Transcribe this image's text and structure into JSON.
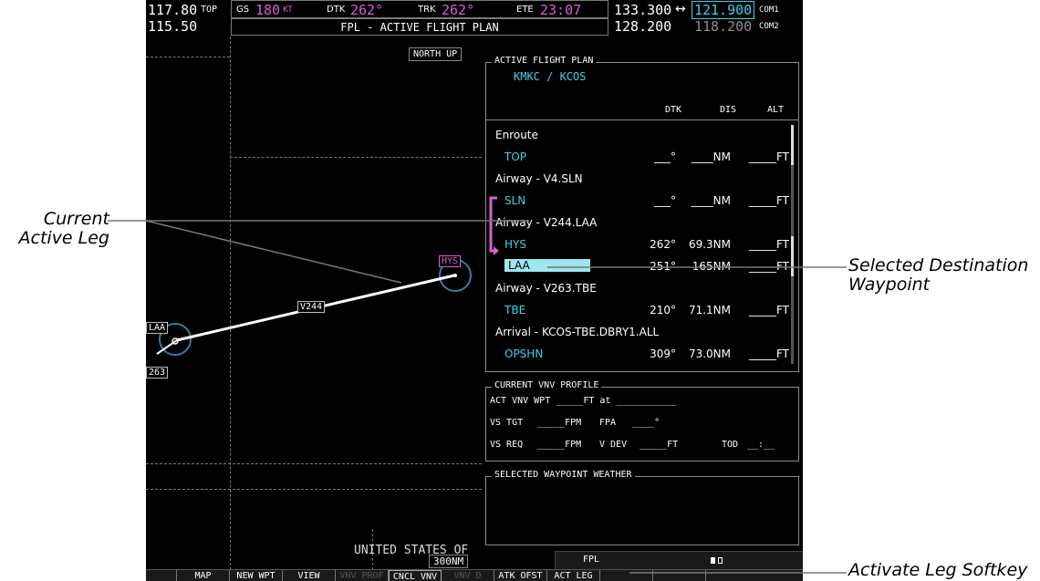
{
  "topbar": {
    "nav1_active": "117.80",
    "nav1_standby": "115.50",
    "top_label": "TOP",
    "gs_label": "GS",
    "gs_value": "180",
    "gs_unit": "KT",
    "dtk_label": "DTK",
    "dtk_value": "262°",
    "trk_label": "TRK",
    "trk_value": "262°",
    "ete_label": "ETE",
    "ete_value": "23:07",
    "page_title": "FPL - ACTIVE FLIGHT PLAN",
    "com1_active": "133.300",
    "com1_standby": "121.900",
    "com1_label": "COM1",
    "com2_active": "128.200",
    "com2_standby": "118.200",
    "com2_label": "COM2",
    "swap_arrow": "↔"
  },
  "map": {
    "orientation": "NORTH UP",
    "range": "300NM",
    "region_label": "UNITED STATES OF",
    "airway_label": "V244",
    "wpt_hys": "HYS",
    "wpt_laa": "LAA",
    "wpt_263": "263"
  },
  "flight_plan": {
    "box_title": "ACTIVE FLIGHT PLAN",
    "route": "KMKC / KCOS",
    "col_dtk": "DTK",
    "col_dis": "DIS",
    "col_alt": "ALT",
    "rows": [
      {
        "name": "Enroute",
        "type": "header",
        "dtk": "",
        "dis": "",
        "alt": ""
      },
      {
        "name": "TOP",
        "type": "wpt",
        "dtk": "___°",
        "dis": "____NM",
        "alt": "_____FT"
      },
      {
        "name": "Airway - V4.SLN",
        "type": "header",
        "dtk": "",
        "dis": "",
        "alt": ""
      },
      {
        "name": "SLN",
        "type": "wpt",
        "dtk": "___°",
        "dis": "____NM",
        "alt": "_____FT"
      },
      {
        "name": "Airway - V244.LAA",
        "type": "header",
        "dtk": "",
        "dis": "",
        "alt": ""
      },
      {
        "name": "HYS",
        "type": "wpt",
        "dtk": "262°",
        "dis": "69.3NM",
        "alt": "_____FT"
      },
      {
        "name": "LAA",
        "type": "selected",
        "dtk": "251°",
        "dis": "165NM",
        "alt": "_____FT"
      },
      {
        "name": "Airway - V263.TBE",
        "type": "header",
        "dtk": "",
        "dis": "",
        "alt": ""
      },
      {
        "name": "TBE",
        "type": "wpt",
        "dtk": "210°",
        "dis": "71.1NM",
        "alt": "_____FT"
      },
      {
        "name": "Arrival - KCOS-TBE.DBRY1.ALL",
        "type": "header",
        "dtk": "",
        "dis": "",
        "alt": ""
      },
      {
        "name": "OPSHN",
        "type": "wpt",
        "dtk": "309°",
        "dis": "73.0NM",
        "alt": "_____FT"
      }
    ]
  },
  "vnv": {
    "box_title": "CURRENT VNV PROFILE",
    "line1": "ACT VNV WPT _____FT at ___________",
    "vs_tgt_label": "VS TGT",
    "vs_tgt_value": "_____FPM",
    "fpa_label": "FPA",
    "fpa_value": "____°",
    "vs_req_label": "VS REQ",
    "vs_req_value": "_____FPM",
    "vdev_label": "V DEV",
    "vdev_value": "_____FT",
    "tod_label": "TOD",
    "tod_value": "__:__"
  },
  "weather": {
    "box_title": "SELECTED WAYPOINT WEATHER"
  },
  "status": {
    "page_group": "FPL"
  },
  "softkeys": [
    {
      "label": "",
      "enabled": false
    },
    {
      "label": "MAP",
      "enabled": true
    },
    {
      "label": "NEW WPT",
      "enabled": true
    },
    {
      "label": "VIEW",
      "enabled": true
    },
    {
      "label": "VNV PROF",
      "enabled": false
    },
    {
      "label": "CNCL VNV",
      "enabled": true
    },
    {
      "label": "VNV D",
      "enabled": false
    },
    {
      "label": "ATK OFST",
      "enabled": true
    },
    {
      "label": "ACT LEG",
      "enabled": true
    },
    {
      "label": "",
      "enabled": false
    },
    {
      "label": "",
      "enabled": false
    },
    {
      "label": "",
      "enabled": false
    }
  ],
  "callouts": {
    "current_active_leg_1": "Current",
    "current_active_leg_2": "Active Leg",
    "selected_dest_1": "Selected Destination",
    "selected_dest_2": "Waypoint",
    "activate_leg": "Activate Leg Softkey"
  },
  "colors": {
    "magenta": "#d85fd8",
    "cyan": "#40d0e8",
    "selection": "#9ee6f0"
  }
}
